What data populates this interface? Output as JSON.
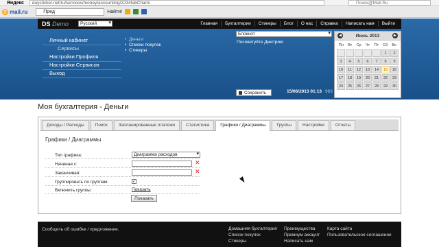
{
  "browser": {
    "yandex_logo": "Яндекс",
    "url": "daysticker.net/ru/services/money/accounting/223#tabCharts",
    "search_placeholder": "Поиск@Mail.Ru",
    "mailru_logo": "mail.ru",
    "toolbar_search_value": "Пред",
    "find_label": "Найти!"
  },
  "site": {
    "logo_main": "DS",
    "logo_demo": "Demo",
    "language": "Русский",
    "nav": [
      "Главная",
      "Бухгалтерии",
      "Стикеры",
      "Блог",
      "О нас",
      "Справка",
      "Написать нам",
      "Выйти"
    ],
    "left_menu": [
      {
        "label": "Личный кабинет",
        "sub": false
      },
      {
        "label": "Сервисы",
        "sub": true
      },
      {
        "label": "Настройки Профиля",
        "sub": false
      },
      {
        "label": "Настройки Сервисов",
        "sub": false
      },
      {
        "label": "Выход",
        "sub": false
      }
    ],
    "sub_menu": [
      "Деньги",
      "Списки покупок",
      "Стикеры"
    ],
    "notebook_select": "Блокнот",
    "advise": "Посоветуйте Дмитрию",
    "save_label": "Сохранить",
    "datetime": "15/06/2013 01:13",
    "counter": "983"
  },
  "calendar": {
    "month": "Июнь 2013",
    "weekdays": [
      "Пн",
      "Вт",
      "Ср",
      "Чт",
      "Пт",
      "Сб",
      "Вс"
    ],
    "days": [
      "",
      "",
      "",
      "",
      "",
      "1",
      "2",
      "3",
      "4",
      "5",
      "6",
      "7",
      "8",
      "9",
      "10",
      "11",
      "12",
      "13",
      "14",
      "15",
      "16",
      "17",
      "18",
      "19",
      "20",
      "21",
      "22",
      "23",
      "24",
      "25",
      "26",
      "27",
      "28",
      "29",
      "30"
    ],
    "today": "15"
  },
  "page": {
    "title": "Моя бухгалтерия - Деньги",
    "tabs": [
      "Доходы / Расходы",
      "Поиск",
      "Запланированные платежи",
      "Статистика",
      "Графики / Диаграммы",
      "Группы",
      "Настройки",
      "Отчеты"
    ],
    "active_tab": "Графики / Диаграммы",
    "section_title": "Графики / Диаграммы",
    "form": {
      "chart_type_label": "Тип графика:",
      "chart_type_value": "Диаграмма расходов",
      "start_label": "Начиная с:",
      "end_label": "Заканчивая:",
      "group_label": "Группировать по группам:",
      "group_checked": "✓",
      "include_groups_label": "Включить группы:",
      "include_groups_link": "Показать",
      "show_button": "Показать"
    }
  },
  "footer": {
    "report": "Сообщить об ошибке / предложение.",
    "col1": [
      "Домашняя бухгалтерия",
      "Список покупок",
      "Стикеры"
    ],
    "col2": [
      "Преимущества",
      "Премиум аккаунт",
      "Написать нам"
    ],
    "col3": [
      "Карта сайта",
      "Пользовательское соглашение"
    ]
  }
}
